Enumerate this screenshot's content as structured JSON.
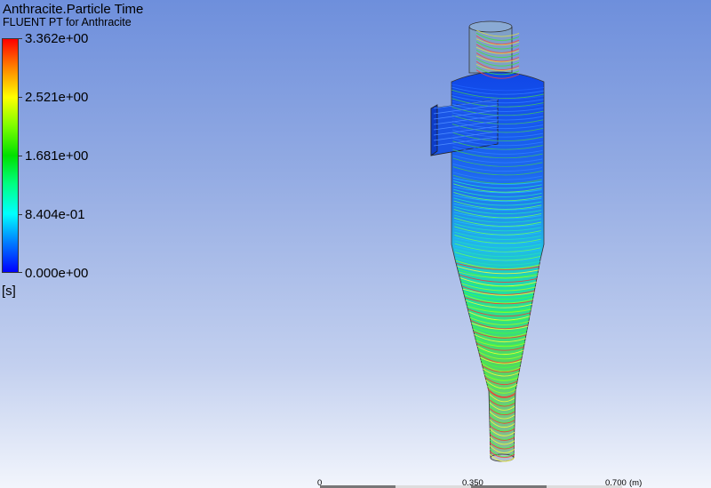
{
  "legend": {
    "title": "Anthracite.Particle Time",
    "subtitle": "FLUENT PT for Anthracite",
    "ticks": [
      "3.362e+00",
      "2.521e+00",
      "1.681e+00",
      "8.404e-01",
      "0.000e+00"
    ],
    "unit": "[s]",
    "range": [
      0,
      3.362
    ]
  },
  "scale": {
    "labels": [
      "0",
      "0.350",
      "0.700"
    ],
    "unit": "(m)"
  }
}
